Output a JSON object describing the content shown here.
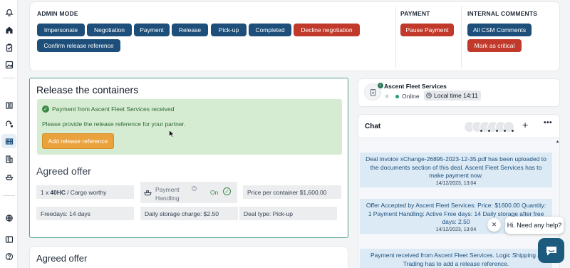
{
  "admin": {
    "section_title": "ADMIN MODE",
    "buttons": [
      "Impersonate",
      "Negotiation",
      "Payment",
      "Release",
      "Pick-up",
      "Completed"
    ],
    "decline": "Decline negotiation",
    "confirm": "Confirm release reference"
  },
  "payment": {
    "section_title": "PAYMENT",
    "pause": "Pause Payment"
  },
  "internal": {
    "section_title": "INTERNAL COMMENTS",
    "all_comments": "All CSM Comments",
    "mark_critical": "Mark as critical"
  },
  "release": {
    "title": "Release the containers",
    "notice": "Payment from Ascent Fleet Services received",
    "instruction": "Please provide the release reference for your partner.",
    "add_button": "Add release reference"
  },
  "agreed_offer": {
    "title": "Agreed offer",
    "quantity_prefix": "1 x",
    "container_type": "40HC",
    "condition": "/ Cargo worthy",
    "payment_handling_label_1": "Payment",
    "payment_handling_label_2": "Handling",
    "payment_handling_value": "On",
    "price": "Price per container $1,600.00",
    "freedays": "Freedays: 14 days",
    "storage": "Daily storage charge: $2.50",
    "deal_type": "Deal type: Pick-up"
  },
  "agreed_offer_2": {
    "title": "Agreed offer"
  },
  "company": {
    "name": "Ascent Fleet Services",
    "status": "Online",
    "local_time": "Local time 14:11"
  },
  "chat": {
    "title": "Chat",
    "plus": "+",
    "more": "•••",
    "messages": [
      {
        "text": "Deal invoice xChange-26895-2023-12-35.pdf has been uploaded to the documents section of this deal. Ascent Fleet Services has to make payment now.",
        "time": "14/12/2023, 13:04"
      },
      {
        "text": "Offer Accepted by Ascent Fleet Services: Price: $1600.00 Quantity: 1 Payment Handling: Active Free days: 14 Daily storage after free days: 2.50",
        "time": "14/12/2023, 13:04"
      },
      {
        "text": "Payment received from Ascent Fleet Services. Logic Shipping & Trading has to add a release reference.",
        "time": ""
      }
    ]
  },
  "help": {
    "bubble": "Hi. Need any help?",
    "close": "✕"
  },
  "colors": {
    "primary": "#1d4f7a",
    "danger": "#c0392b",
    "success_bg": "#d6ecd2",
    "success_text": "#2f6b35",
    "accent_orange": "#eaa23d",
    "highlight_border": "#4f9e8a"
  }
}
